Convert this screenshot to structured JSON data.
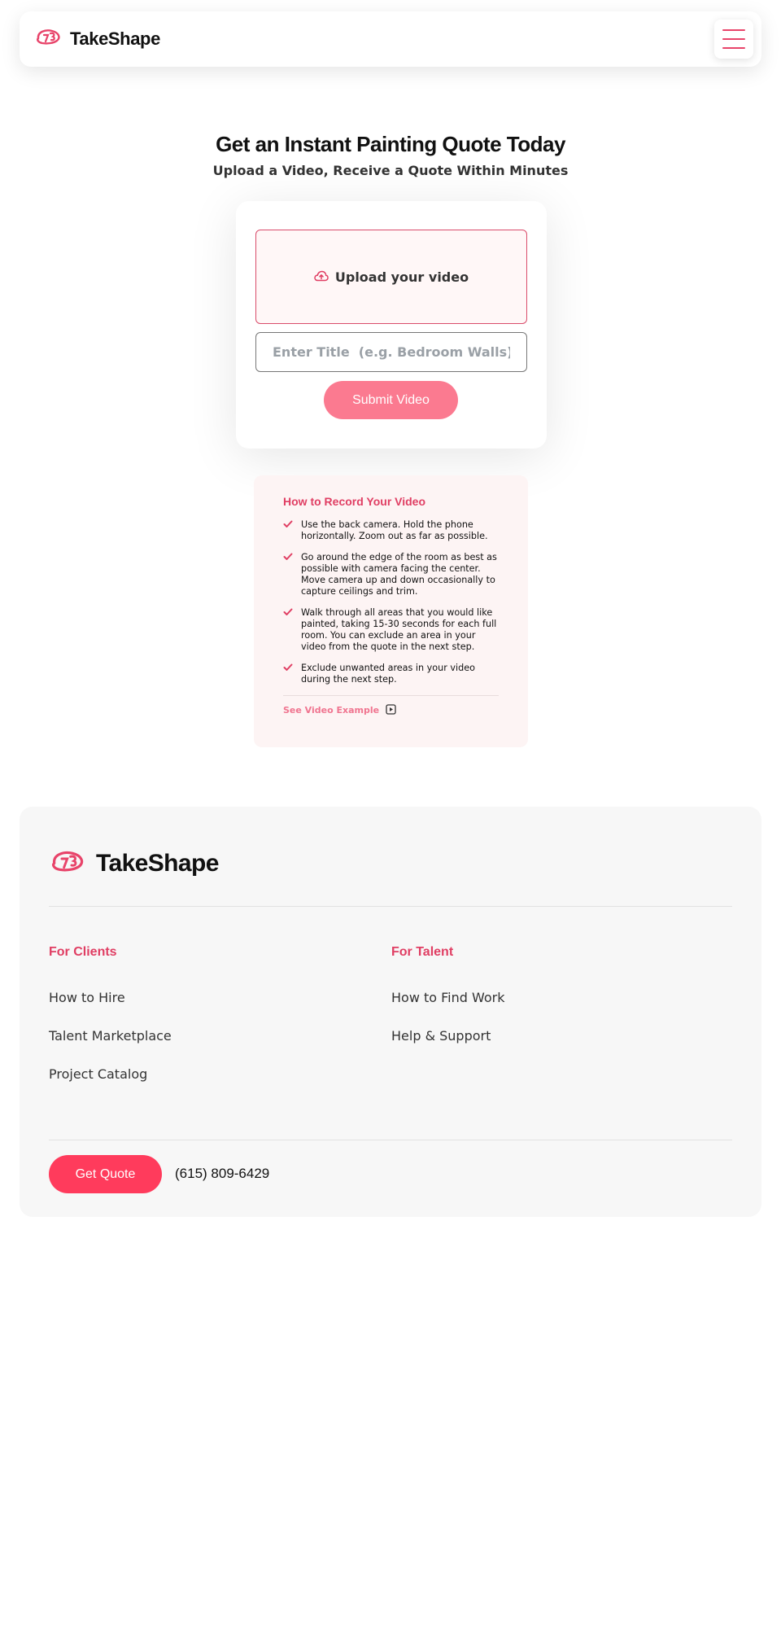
{
  "header": {
    "brand_name": "TakeShape"
  },
  "hero": {
    "title": "Get an Instant Painting Quote Today",
    "subtitle": "Upload a Video, Receive a Quote Within Minutes"
  },
  "upload": {
    "dropzone_label": "Upload your video",
    "title_placeholder": "Enter Title  (e.g. Bedroom Walls)",
    "submit_label": "Submit Video"
  },
  "howto": {
    "title": "How to Record Your Video",
    "steps": [
      "Use the back camera. Hold the phone horizontally. Zoom out as far as possible.",
      "Go around the edge of the room as best as possible with camera facing the center. Move camera up and down occasionally to capture ceilings and trim.",
      "Walk through all areas that you would like painted, taking 15-30 seconds for each full room. You can exclude an area in your video from the quote in the next step.",
      "Exclude unwanted areas in your video during the next step."
    ],
    "video_link": "See Video Example"
  },
  "footer": {
    "brand_name": "TakeShape",
    "clients": {
      "heading": "For Clients",
      "links": [
        "How to Hire",
        "Talent Marketplace",
        "Project Catalog"
      ]
    },
    "talent": {
      "heading": "For Talent",
      "links": [
        "How to Find Work",
        "Help & Support"
      ]
    },
    "cta_label": "Get Quote",
    "phone": "(615) 809-6429"
  },
  "colors": {
    "accent": "#e03e63",
    "cta": "#ff3b5c",
    "submit": "#fb7a90"
  }
}
